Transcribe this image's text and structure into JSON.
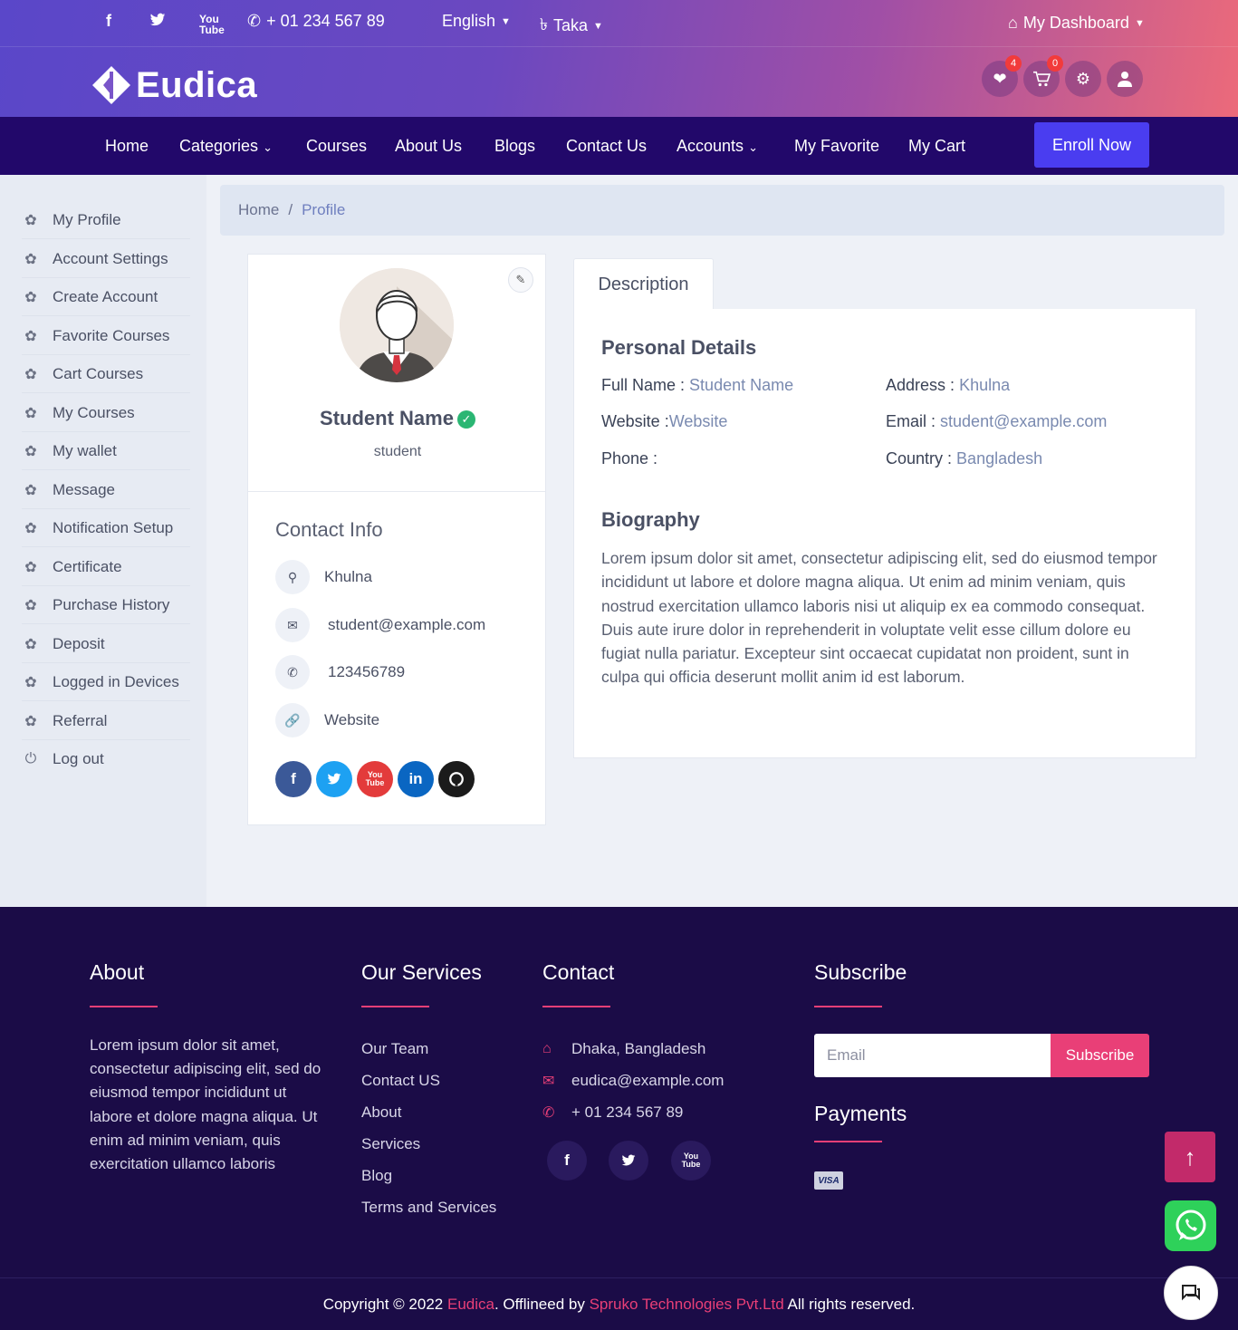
{
  "topbar": {
    "phone": "+ 01 234 567 89",
    "language": "English",
    "currency": "Taka",
    "dashboard": "My Dashboard"
  },
  "brand": {
    "name": "Eudica"
  },
  "header_icons": {
    "favorites_count": "4",
    "cart_count": "0"
  },
  "nav": {
    "home": "Home",
    "categories": "Categories",
    "courses": "Courses",
    "about": "About Us",
    "blogs": "Blogs",
    "contact": "Contact Us",
    "accounts": "Accounts",
    "favorite": "My Favorite",
    "cart": "My Cart",
    "enroll": "Enroll Now"
  },
  "sidebar": {
    "items": [
      {
        "label": "My Profile"
      },
      {
        "label": "Account Settings"
      },
      {
        "label": "Create Account"
      },
      {
        "label": "Favorite Courses"
      },
      {
        "label": "Cart Courses"
      },
      {
        "label": "My Courses"
      },
      {
        "label": "My wallet"
      },
      {
        "label": "Message"
      },
      {
        "label": "Notification Setup"
      },
      {
        "label": "Certificate"
      },
      {
        "label": "Purchase History"
      },
      {
        "label": "Deposit"
      },
      {
        "label": "Logged in Devices"
      },
      {
        "label": "Referral"
      },
      {
        "label": "Log out"
      }
    ]
  },
  "breadcrumb": {
    "home": "Home",
    "separator": "/",
    "current": "Profile"
  },
  "profile": {
    "name": "Student Name",
    "role": "student",
    "contact_title": "Contact Info",
    "address": "Khulna",
    "email": "student@example.com",
    "phone": "123456789",
    "website": "Website"
  },
  "description": {
    "tab": "Description",
    "personal_title": "Personal Details",
    "full_name_label": "Full Name :",
    "full_name": "Student Name",
    "address_label": "Address :",
    "address": "Khulna",
    "website_label": "Website :",
    "website": "Website",
    "email_label": "Email :",
    "email": "student@example.com",
    "phone_label": "Phone :",
    "country_label": "Country :",
    "country": "Bangladesh",
    "bio_title": "Biography",
    "bio": "Lorem ipsum dolor sit amet, consectetur adipiscing elit, sed do eiusmod tempor incididunt ut labore et dolore magna aliqua. Ut enim ad minim veniam, quis nostrud exercitation ullamco laboris nisi ut aliquip ex ea commodo consequat. Duis aute irure dolor in reprehenderit in voluptate velit esse cillum dolore eu fugiat nulla pariatur. Excepteur sint occaecat cupidatat non proident, sunt in culpa qui officia deserunt mollit anim id est laborum."
  },
  "footer": {
    "about_title": "About",
    "about_text": "Lorem ipsum dolor sit amet, consectetur adipiscing elit, sed do eiusmod tempor incididunt ut labore et dolore magna aliqua. Ut enim ad minim veniam, quis exercitation ullamco laboris",
    "services_title": "Our Services",
    "services": [
      "Our Team",
      "Contact US",
      "About",
      "Services",
      "Blog",
      "Terms and Services"
    ],
    "contact_title": "Contact",
    "contact_address": "Dhaka, Bangladesh",
    "contact_email": "eudica@example.com",
    "contact_phone": "+ 01 234 567 89",
    "subscribe_title": "Subscribe",
    "email_placeholder": "Email",
    "subscribe_button": "Subscribe",
    "payments_title": "Payments",
    "visa": "VISA",
    "copyright_prefix": "Copyright © 2022 ",
    "copyright_brand": "Eudica",
    "copyright_mid": ". Offlineed by ",
    "copyright_company": "Spruko Technologies Pvt.Ltd",
    "copyright_suffix": " All rights reserved."
  },
  "colors": {
    "nav_bg": "#22086a",
    "footer_bg": "#1b0c47",
    "accent_pink": "#e93f77",
    "enroll_button": "#4a3df0"
  }
}
